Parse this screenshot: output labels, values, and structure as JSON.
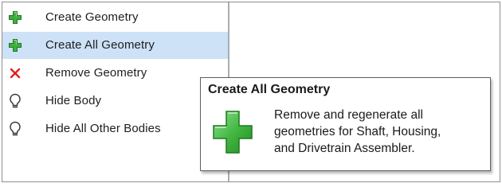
{
  "context_menu": {
    "items": [
      {
        "label": "Create Geometry",
        "icon": "plus-icon"
      },
      {
        "label": "Create All Geometry",
        "icon": "plus-icon",
        "selected": true
      },
      {
        "label": "Remove Geometry",
        "icon": "red-x-icon"
      },
      {
        "label": "Hide Body",
        "icon": "lightbulb-icon"
      },
      {
        "label": "Hide All Other Bodies",
        "icon": "lightbulb-icon"
      }
    ]
  },
  "tooltip": {
    "title": "Create All Geometry",
    "icon": "large-plus-icon",
    "description_lines": [
      "Remove and regenerate all",
      "geometries for Shaft, Housing,",
      "and Drivetrain Assembler."
    ]
  },
  "colors": {
    "selection_bg": "#cde1f7",
    "plus_green": "#3aa83a",
    "remove_red": "#e02020"
  }
}
